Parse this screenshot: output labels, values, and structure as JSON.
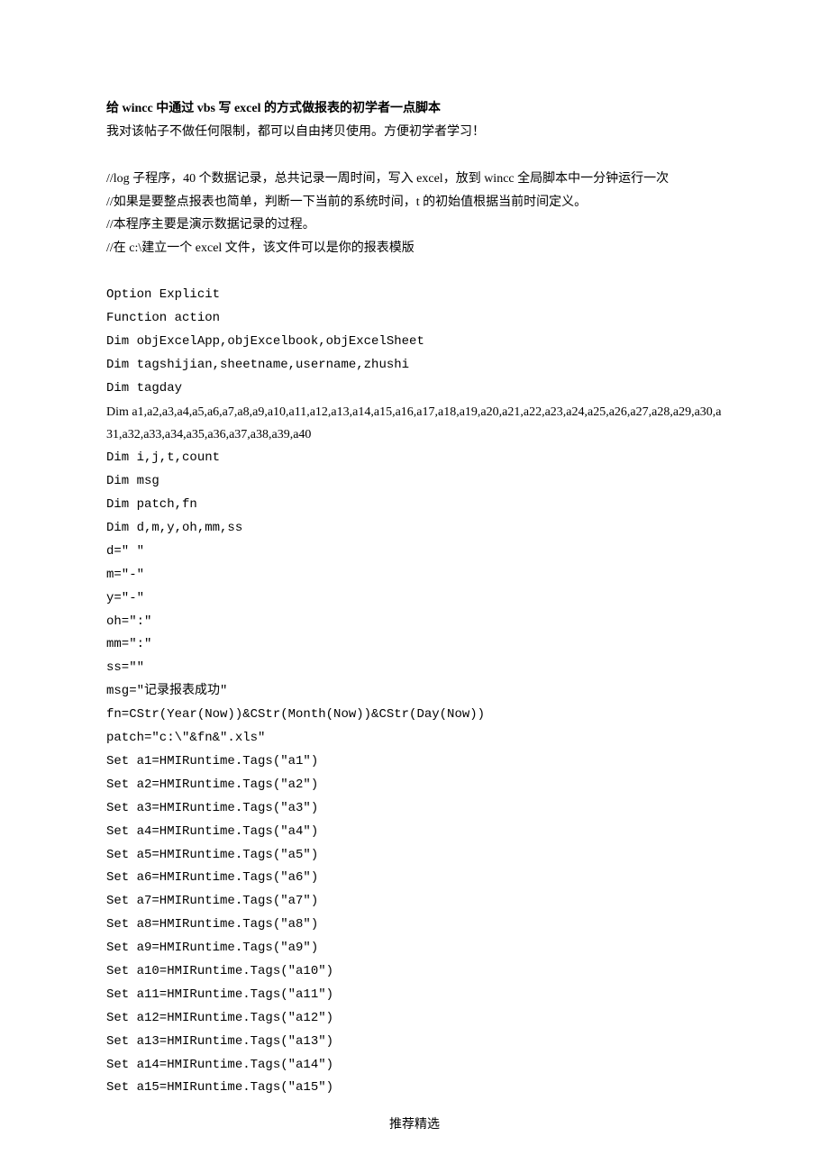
{
  "title_parts": {
    "p1": "给 ",
    "p2": "wincc",
    "p3": " 中通过 ",
    "p4": "vbs",
    "p5": " 写 ",
    "p6": "excel",
    "p7": " 的方式做报表的初学者一点脚本"
  },
  "intro": "我对该帖子不做任何限制，都可以自由拷贝使用。方便初学者学习！",
  "comments": [
    "//log 子程序，40 个数据记录，总共记录一周时间，写入 excel，放到 wincc 全局脚本中一分钟运行一次",
    "//如果是要整点报表也简单，判断一下当前的系统时间，t 的初始值根据当前时间定义。",
    "//本程序主要是演示数据记录的过程。",
    "//在 c:\\建立一个 excel 文件，该文件可以是你的报表模版"
  ],
  "code_lines": [
    "Option Explicit",
    "Function action",
    "Dim objExcelApp,objExcelbook,objExcelSheet",
    "Dim tagshijian,sheetname,username,zhushi",
    "Dim tagday",
    "Dim a1,a2,a3,a4,a5,a6,a7,a8,a9,a10,a11,a12,a13,a14,a15,a16,a17,a18,a19,a20,a21,a22,a23,a24,a25,a26,a27,a28,a29,a30,a31,a32,a33,a34,a35,a36,a37,a38,a39,a40",
    "Dim i,j,t,count",
    "Dim msg",
    "Dim patch,fn",
    "Dim d,m,y,oh,mm,ss",
    "d=\" \"",
    "m=\"-\"",
    "y=\"-\"",
    "oh=\":\"",
    "mm=\":\"",
    "ss=\"\"",
    "msg=\"记录报表成功\"",
    "fn=CStr(Year(Now))&CStr(Month(Now))&CStr(Day(Now))",
    "patch=\"c:\\\"&fn&\".xls\"",
    "Set a1=HMIRuntime.Tags(\"a1\")",
    "Set a2=HMIRuntime.Tags(\"a2\")",
    "Set a3=HMIRuntime.Tags(\"a3\")",
    "Set a4=HMIRuntime.Tags(\"a4\")",
    "Set a5=HMIRuntime.Tags(\"a5\")",
    "Set a6=HMIRuntime.Tags(\"a6\")",
    "Set a7=HMIRuntime.Tags(\"a7\")",
    "Set a8=HMIRuntime.Tags(\"a8\")",
    "Set a9=HMIRuntime.Tags(\"a9\")",
    "Set a10=HMIRuntime.Tags(\"a10\")",
    "Set a11=HMIRuntime.Tags(\"a11\")",
    "Set a12=HMIRuntime.Tags(\"a12\")",
    "Set a13=HMIRuntime.Tags(\"a13\")",
    "Set a14=HMIRuntime.Tags(\"a14\")",
    "Set a15=HMIRuntime.Tags(\"a15\")"
  ],
  "footer": "推荐精选"
}
